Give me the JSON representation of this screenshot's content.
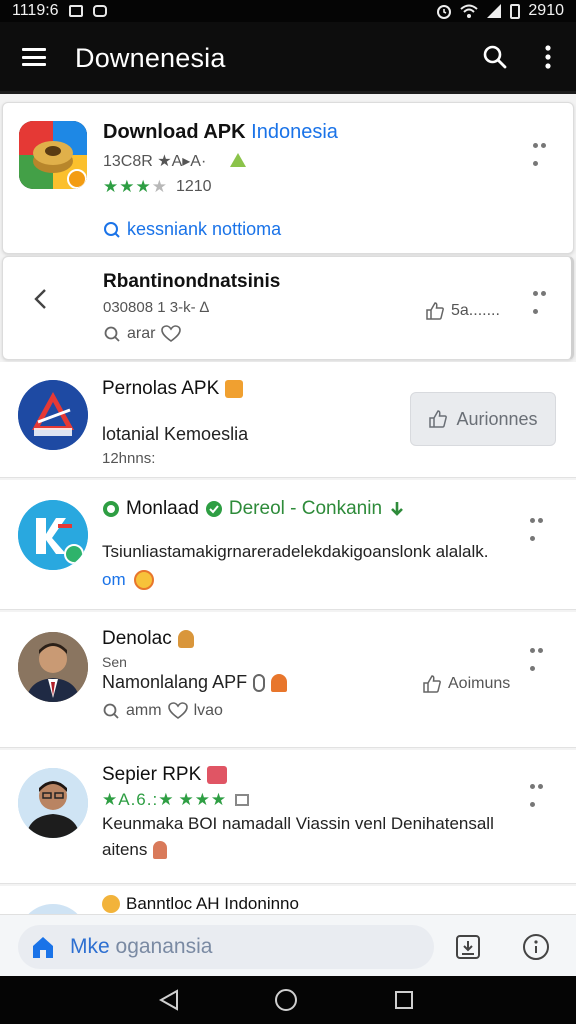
{
  "status_bar": {
    "time_left": "1119:6",
    "time_right": "2910"
  },
  "app_bar": {
    "title": "Downenesia"
  },
  "cards": [
    {
      "title_main": "Download APK",
      "title_accent": "Indonesia",
      "meta": "13C8R ★A▸A·",
      "stars_on": "★★★",
      "stars_off": "★",
      "rating_count": "1210",
      "link": "kessniank nottioma"
    },
    {
      "title": "Rbantinondnatsinis",
      "meta": "030808 1 3-k- ∆",
      "action_left": "arar",
      "action_right": "5a.......",
      "icon": "chevron-left-icon"
    },
    {
      "title": "Pernolas APK",
      "body": "lotanial Kemoeslia",
      "meta": "12hnns:",
      "button": "Aurionnes"
    },
    {
      "title_pre": "Monlaad",
      "title_accent": "Dereol - Conkanin",
      "body": "Tsiunliastamakigrnareradelekdakigoanslonk alalalk.",
      "body_tail": "om"
    },
    {
      "title": "Denolac",
      "meta": "Sen",
      "body": "Namonlalang APF",
      "action_left": "amm",
      "action_mid": "lvao",
      "action_right": "Aoimuns"
    },
    {
      "title": "Sepier RPK",
      "stars_prefix": "★A.6.:★",
      "stars": "★★★",
      "body": "Keunmaka BOI namadall Viassin venl Denihatensall",
      "body_tail": "aitens"
    },
    {
      "title": "Banntloc AH Indoninno"
    }
  ],
  "bottom_bar": {
    "search_main": "Mke",
    "search_rest": " oganansia"
  },
  "colors": {
    "accent": "#1a73e8",
    "star": "#2e9e43",
    "app_bar": "#0d0d0d"
  }
}
